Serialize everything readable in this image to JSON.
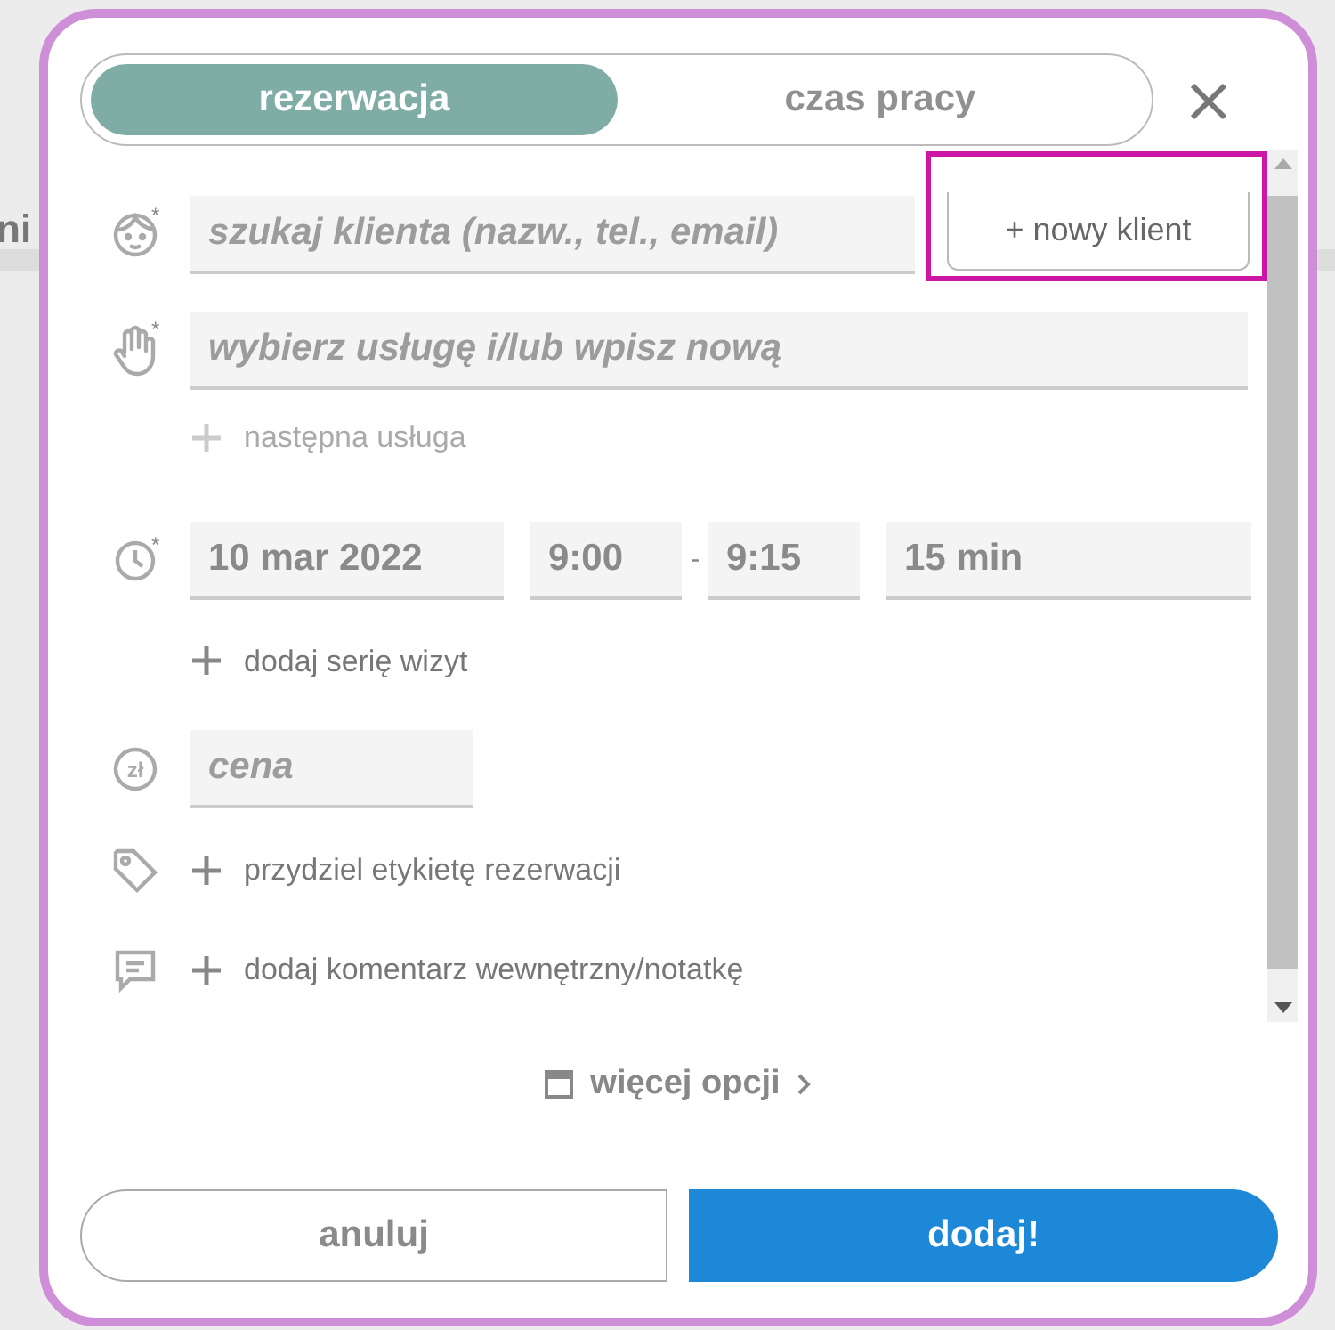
{
  "background": {
    "fragment": "ni"
  },
  "tabs": [
    {
      "label": "rezerwacja",
      "selected": true
    },
    {
      "label": "czas pracy",
      "selected": false
    }
  ],
  "client": {
    "mark": "*",
    "placeholder": "szukaj klienta (nazw., tel., email)",
    "new_button": "+ nowy klient",
    "highlighted": true
  },
  "service": {
    "mark": "*",
    "placeholder": "wybierz usługę i/lub wpisz nową",
    "next_link": {
      "label": "następna usługa",
      "disabled": true
    }
  },
  "time": {
    "mark": "*",
    "date": "10 mar 2022",
    "start": "9:00",
    "separator": "-",
    "end": "9:15",
    "duration": "15 min",
    "series_link": "dodaj serię wizyt"
  },
  "price": {
    "icon_text": "zł",
    "placeholder": "cena"
  },
  "tag_link": "przydziel etykietę rezerwacji",
  "comment_link": "dodaj komentarz wewnętrzny/notatkę",
  "more_options": "więcej opcji",
  "buttons": [
    {
      "label": "anuluj",
      "kind": "secondary"
    },
    {
      "label": "dodaj!",
      "kind": "primary"
    }
  ]
}
